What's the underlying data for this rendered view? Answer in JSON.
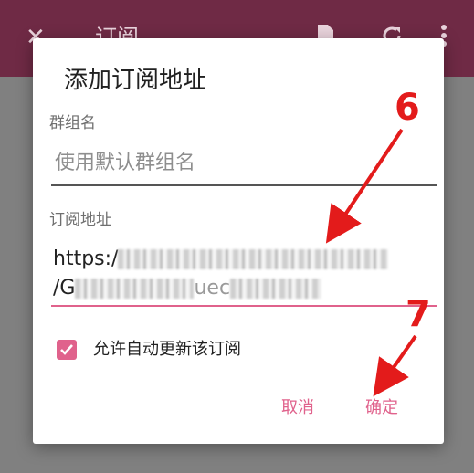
{
  "appbar": {
    "title": "订阅",
    "close_icon": "close-icon",
    "file_icon": "file-icon",
    "refresh_icon": "refresh-icon",
    "more_icon": "more-vert-icon"
  },
  "dialog": {
    "title": "添加订阅地址",
    "group": {
      "label": "群组名",
      "placeholder": "使用默认群组名"
    },
    "url": {
      "label": "订阅地址",
      "line1_prefix": "https:/",
      "line2_prefix": "/G",
      "line2_visible_fragment": "uec"
    },
    "auto_update_label": "允许自动更新该订阅",
    "auto_update_checked": true,
    "cancel_label": "取消",
    "ok_label": "确定"
  },
  "annotations": [
    {
      "label": "6",
      "color": "#e31b1b"
    },
    {
      "label": "7",
      "color": "#e31b1b"
    }
  ],
  "colors": {
    "appbar": "#6f2a45",
    "accent": "#e0628c",
    "annotation": "#e31b1b"
  }
}
